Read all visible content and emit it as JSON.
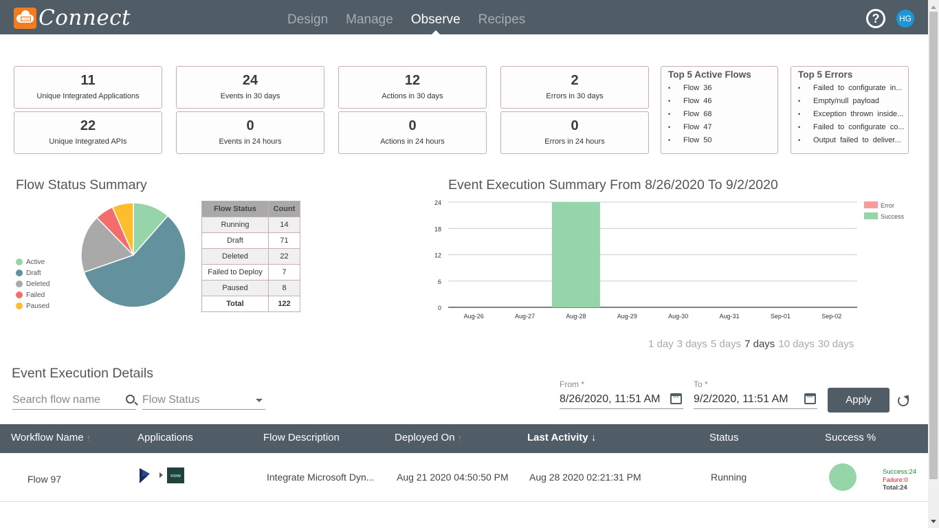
{
  "app": {
    "title": "Connect",
    "nav": [
      {
        "label": "Design",
        "active": false
      },
      {
        "label": "Manage",
        "active": false
      },
      {
        "label": "Observe",
        "active": true
      },
      {
        "label": "Recipes",
        "active": false
      }
    ],
    "help_icon": "?",
    "user_initials": "HG"
  },
  "stats": [
    {
      "value": "11",
      "label": "Unique Integrated Applications"
    },
    {
      "value": "24",
      "label": "Events in 30 days"
    },
    {
      "value": "12",
      "label": "Actions in 30 days"
    },
    {
      "value": "2",
      "label": "Errors in 30 days"
    },
    {
      "value": "22",
      "label": "Unique Integrated APIs"
    },
    {
      "value": "0",
      "label": "Events in 24 hours"
    },
    {
      "value": "0",
      "label": "Actions in 24 hours"
    },
    {
      "value": "0",
      "label": "Errors in 24 hours"
    }
  ],
  "top_active_flows": {
    "title": "Top 5 Active Flows",
    "items": [
      "Flow 36",
      "Flow 46",
      "Flow 68",
      "Flow 47",
      "Flow 50"
    ]
  },
  "top_errors": {
    "title": "Top 5 Errors",
    "items": [
      "Failed to configurate in...",
      "Empty/null payload",
      "Exception thrown inside...",
      "Failed to configurate co...",
      "Output failed to deliver..."
    ]
  },
  "flow_status": {
    "title": "Flow Status Summary",
    "legend": [
      {
        "label": "Active",
        "color": "#95d5a9"
      },
      {
        "label": "Draft",
        "color": "#63919e"
      },
      {
        "label": "Deleted",
        "color": "#a9a9a9"
      },
      {
        "label": "Failed",
        "color": "#f46d6d"
      },
      {
        "label": "Paused",
        "color": "#fdbd2c"
      }
    ],
    "table": {
      "headers": [
        "Flow Status",
        "Count"
      ],
      "rows": [
        [
          "Running",
          "14"
        ],
        [
          "Draft",
          "71"
        ],
        [
          "Deleted",
          "22"
        ],
        [
          "Failed to Deploy",
          "7"
        ],
        [
          "Paused",
          "8"
        ]
      ],
      "total": [
        "Total",
        "122"
      ]
    }
  },
  "chart_data": [
    {
      "type": "pie",
      "title": "Flow Status Summary",
      "categories": [
        "Active",
        "Draft",
        "Deleted",
        "Failed",
        "Paused"
      ],
      "values": [
        14,
        71,
        22,
        7,
        8
      ],
      "colors": [
        "#95d5a9",
        "#63919e",
        "#a9a9a9",
        "#f46d6d",
        "#fdbd2c"
      ],
      "legend": "left"
    },
    {
      "type": "bar",
      "title": "Event Execution Summary From 8/26/2020 To 9/2/2020",
      "categories": [
        "Aug-26",
        "Aug-27",
        "Aug-28",
        "Aug-29",
        "Aug-30",
        "Aug-31",
        "Sep-01",
        "Sep-02"
      ],
      "series": [
        {
          "name": "Error",
          "color": "#fa9a9a",
          "values": [
            0,
            0,
            0,
            0,
            0,
            0,
            0,
            0
          ]
        },
        {
          "name": "Success",
          "color": "#95d5a9",
          "values": [
            0,
            0,
            24,
            0,
            0,
            0,
            0,
            0
          ]
        }
      ],
      "stacked": true,
      "yticks": [
        0,
        6,
        12,
        18,
        24
      ],
      "ylim": [
        0,
        24
      ],
      "xlabel": "",
      "ylabel": "",
      "grid": true,
      "legend": "top-right"
    }
  ],
  "range_options": [
    {
      "label": "1 day",
      "active": false
    },
    {
      "label": "3 days",
      "active": false
    },
    {
      "label": "5 days",
      "active": false
    },
    {
      "label": "7 days",
      "active": true
    },
    {
      "label": "10 days",
      "active": false
    },
    {
      "label": "30 days",
      "active": false
    }
  ],
  "details": {
    "title": "Event Execution Details",
    "search_placeholder": "Search flow name",
    "status_placeholder": "Flow Status",
    "from_label": "From *",
    "from_value": "8/26/2020, 11:51 AM",
    "to_label": "To *",
    "to_value": "9/2/2020, 11:51 AM",
    "apply_label": "Apply",
    "columns": [
      "Workflow Name",
      "Applications",
      "Flow Description",
      "Deployed On",
      "Last Activity",
      "Status",
      "Success %"
    ],
    "sort_up": "↑",
    "sort_down": "↓",
    "rows": [
      {
        "name": "Flow 97",
        "apps": [
          "microsoft-dynamics",
          "servicenow"
        ],
        "app_now_text": "now",
        "description": "Integrate Microsoft Dyn...",
        "deployed_on": "Aug 21 2020 04:50:50 PM",
        "last_activity": "Aug 28 2020 02:21:31 PM",
        "status": "Running",
        "success_pct": 100,
        "success": "Success:24",
        "failure": "Failure:0",
        "total": "Total:24"
      }
    ]
  }
}
